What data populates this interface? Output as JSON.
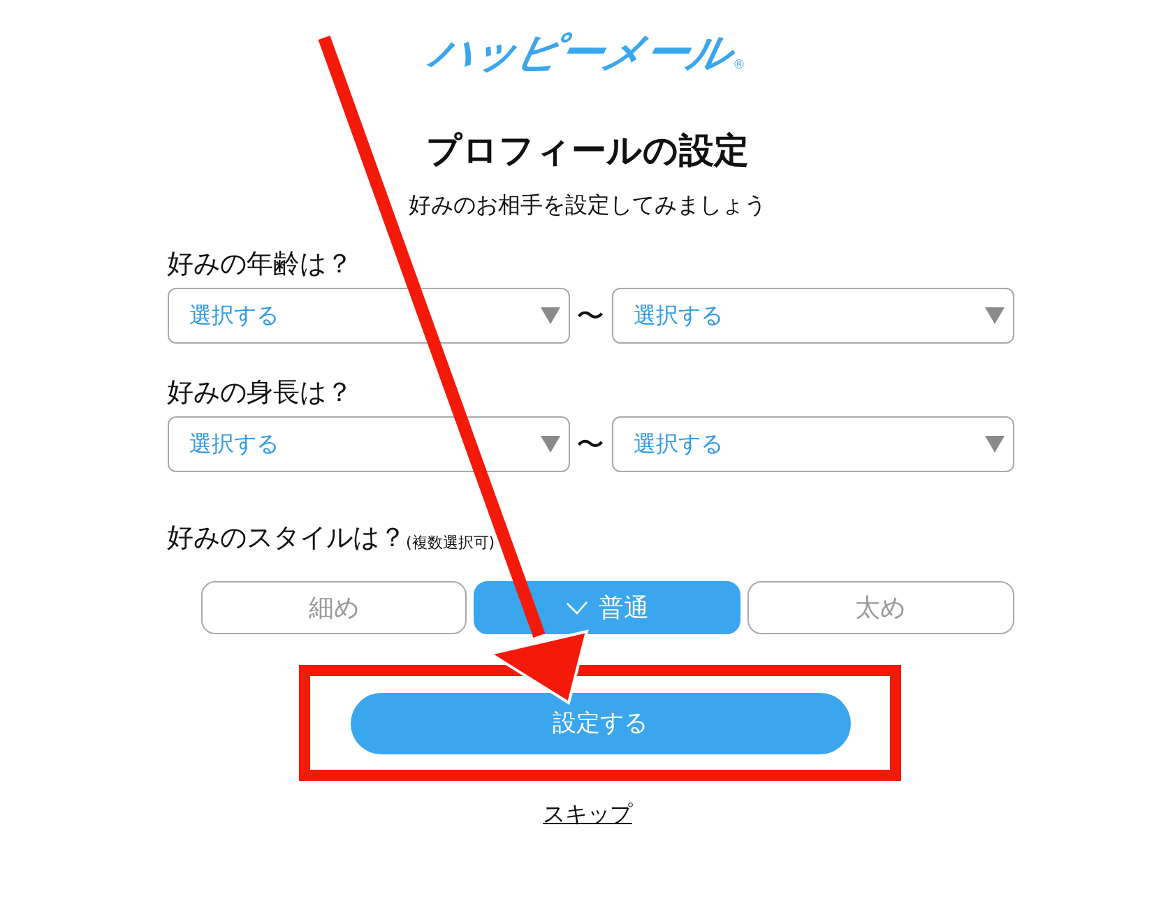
{
  "logo": {
    "text": "ハッピーメール",
    "mark": "®"
  },
  "title": "プロフィールの設定",
  "subtitle": "好みのお相手を設定してみましょう",
  "range_fields": [
    {
      "label": "好みの年齢は？",
      "from": {
        "value": "選択する"
      },
      "separator": "〜",
      "to": {
        "value": "選択する"
      }
    },
    {
      "label": "好みの身長は？",
      "from": {
        "value": "選択する"
      },
      "separator": "〜",
      "to": {
        "value": "選択する"
      }
    }
  ],
  "style": {
    "label": "好みのスタイルは？",
    "note": "(複数選択可)",
    "options": [
      {
        "label": "細め",
        "selected": false
      },
      {
        "label": "普通",
        "selected": true
      },
      {
        "label": "太め",
        "selected": false
      }
    ]
  },
  "submit": "設定する",
  "skip": "スキップ"
}
